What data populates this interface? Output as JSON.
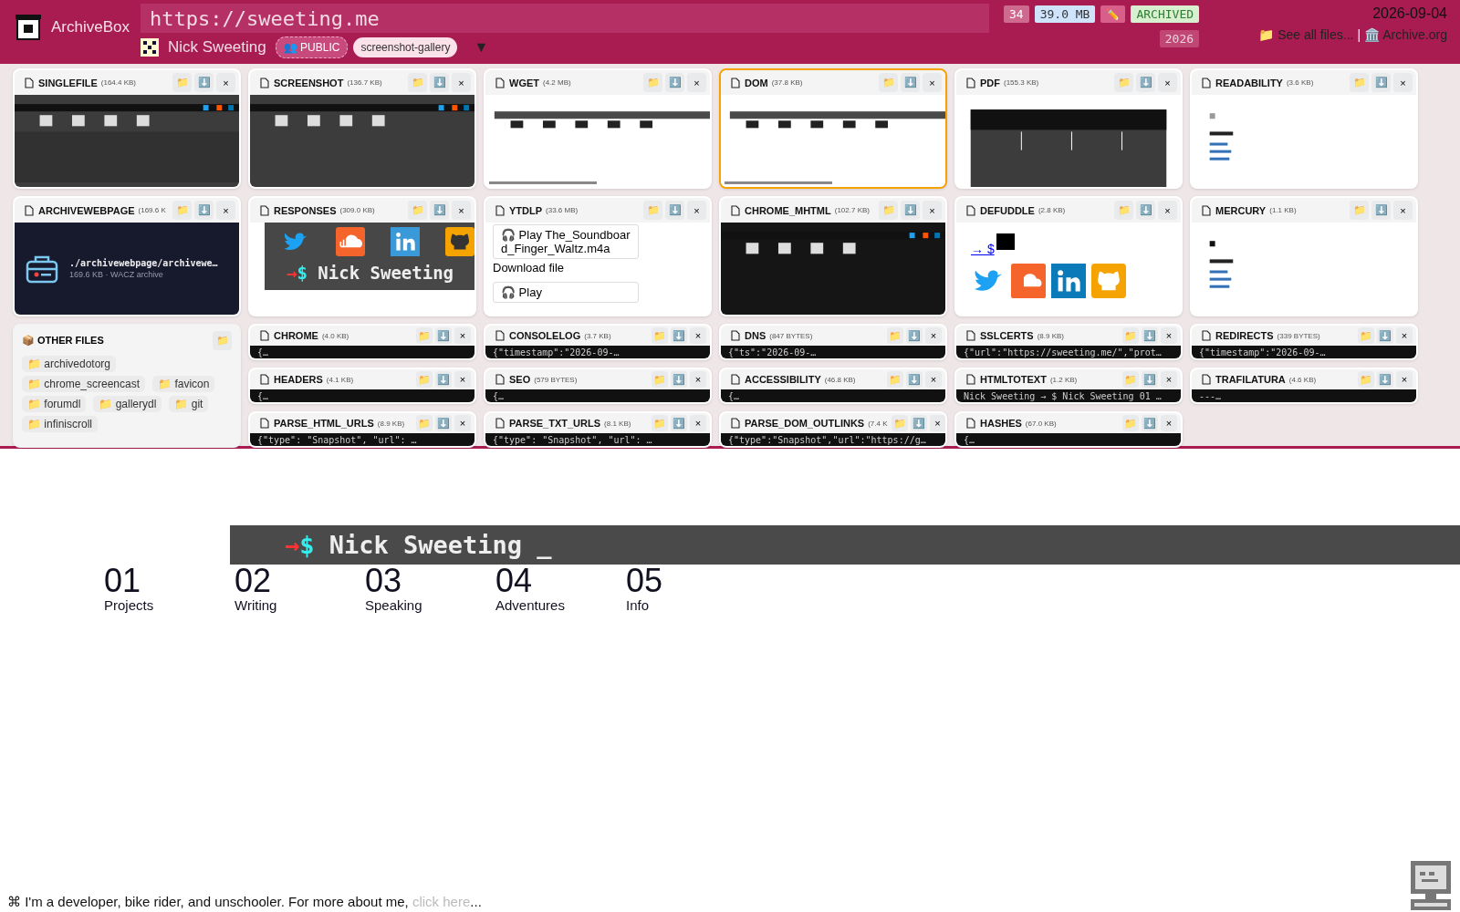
{
  "header": {
    "logo_text": "ArchiveBox",
    "url": "https://sweeting.me",
    "title": "Nick Sweeting",
    "tags": [
      {
        "kind": "public",
        "icon": "👥",
        "label": "PUBLIC"
      },
      {
        "kind": "tag",
        "label": "screenshot-gallery"
      }
    ],
    "dropdown": "▼",
    "count": "34",
    "size": "39.0 MB",
    "edit": "✏️",
    "status": "ARCHIVED",
    "year": "2026",
    "date": "2026-09-04",
    "files_link": "📁 See all files...",
    "separator": "|",
    "archive_link": "🏛️ Archive.org"
  },
  "cards": [
    {
      "name": "SINGLEFILE",
      "size": "(164.4 KB)",
      "selected": false,
      "kind": "picture",
      "actions": [
        "📁",
        "⬇️",
        "×"
      ]
    },
    {
      "name": "SCREENSHOT",
      "size": "(136.7 KB)",
      "selected": false,
      "kind": "picture",
      "actions": [
        "📁",
        "⬇️",
        "×"
      ]
    },
    {
      "name": "WGET",
      "size": "(4.2 MB)",
      "selected": false,
      "kind": "picture",
      "actions": [
        "📁",
        "⬇️",
        "×"
      ]
    },
    {
      "name": "DOM",
      "size": "(37.8 KB)",
      "selected": true,
      "kind": "picture",
      "actions": [
        "📁",
        "⬇️",
        "×"
      ]
    },
    {
      "name": "PDF",
      "size": "(155.3 KB)",
      "selected": false,
      "kind": "picture",
      "actions": [
        "📁",
        "⬇️",
        "×"
      ]
    },
    {
      "name": "READABILITY",
      "size": "(3.6 KB)",
      "selected": false,
      "kind": "picture",
      "actions": [
        "📁",
        "⬇️",
        "×"
      ]
    },
    {
      "name": "ARCHIVEWEBPAGE",
      "size": "(169.6 K",
      "selected": false,
      "kind": "archive",
      "path": "./archivewebpage/archivewe…",
      "detail": "169.6 KB · WACZ archive",
      "actions": [
        "📁",
        "⬇️",
        "×"
      ]
    },
    {
      "name": "RESPONSES",
      "size": "(309.0 KB)",
      "selected": false,
      "kind": "responses",
      "prompt": "→$",
      "text": "Nick Sweeting",
      "actions": [
        "📁",
        "⬇️",
        "×"
      ]
    },
    {
      "name": "YTDLP",
      "size": "(33.6 MB)",
      "selected": false,
      "kind": "media",
      "items": [
        {
          "kind": "play",
          "icon": "🎧",
          "label": "Play The_Soundboard_Finger_Waltz.m4a"
        },
        {
          "kind": "link",
          "label": "Download file"
        },
        {
          "kind": "play",
          "icon": "🎧",
          "label": "Play"
        }
      ],
      "actions": [
        "📁",
        "⬇️",
        "×"
      ]
    },
    {
      "name": "CHROME_MHTML",
      "size": "(102.7 KB)",
      "selected": false,
      "kind": "picture",
      "actions": [
        "📁",
        "⬇️",
        "×"
      ]
    },
    {
      "name": "DEFUDDLE",
      "size": "(2.8 KB)",
      "selected": false,
      "kind": "links",
      "link": "→ $",
      "actions": [
        "📁",
        "⬇️",
        "×"
      ]
    },
    {
      "name": "MERCURY",
      "size": "(1.1 KB)",
      "selected": false,
      "kind": "picture",
      "actions": [
        "📁",
        "⬇️",
        "×"
      ]
    }
  ],
  "other_files": {
    "title": "📦 OTHER FILES",
    "action": "📁",
    "folders": [
      "📁 archivedotorg",
      "📁 chrome_screencast",
      "📁 favicon",
      "📁 forumdl",
      "📁 gallerydl",
      "📁 git",
      "📁 infiniscroll"
    ]
  },
  "text_cards": [
    {
      "name": "CHROME",
      "size": "(4.0 KB)",
      "snippet": "{…",
      "actions": [
        "📁",
        "⬇️",
        "×"
      ]
    },
    {
      "name": "CONSOLELOG",
      "size": "(3.7 KB)",
      "snippet": "{\"timestamp\":\"2026-09-…",
      "actions": [
        "📁",
        "⬇️",
        "×"
      ]
    },
    {
      "name": "DNS",
      "size": "(847 BYTES)",
      "snippet": "{\"ts\":\"2026-09-…",
      "actions": [
        "📁",
        "⬇️",
        "×"
      ]
    },
    {
      "name": "SSLCERTS",
      "size": "(8.9 KB)",
      "snippet": "{\"url\":\"https://sweeting.me/\",\"prot…",
      "actions": [
        "📁",
        "⬇️",
        "×"
      ]
    },
    {
      "name": "REDIRECTS",
      "size": "(339 BYTES)",
      "snippet": "{\"timestamp\":\"2026-09-…",
      "actions": [
        "📁",
        "⬇️",
        "×"
      ]
    },
    {
      "name": "HEADERS",
      "size": "(4.1 KB)",
      "snippet": "{…",
      "actions": [
        "📁",
        "⬇️",
        "×"
      ]
    },
    {
      "name": "SEO",
      "size": "(579 BYTES)",
      "snippet": "{…",
      "actions": [
        "📁",
        "⬇️",
        "×"
      ]
    },
    {
      "name": "ACCESSIBILITY",
      "size": "(46.8 KB)",
      "snippet": "{…",
      "actions": [
        "📁",
        "⬇️",
        "×"
      ]
    },
    {
      "name": "HTMLTOTEXT",
      "size": "(1.2 KB)",
      "snippet": "Nick Sweeting → $ Nick Sweeting 01 …",
      "actions": [
        "📁",
        "⬇️",
        "×"
      ]
    },
    {
      "name": "TRAFILATURA",
      "size": "(4.6 KB)",
      "snippet": "---…",
      "actions": [
        "📁",
        "⬇️",
        "×"
      ]
    },
    {
      "name": "PARSE_HTML_URLS",
      "size": "(8.9 KB)",
      "snippet": "{\"type\": \"Snapshot\", \"url\": …",
      "actions": [
        "📁",
        "⬇️",
        "×"
      ]
    },
    {
      "name": "PARSE_TXT_URLS",
      "size": "(8.1 KB)",
      "snippet": "{\"type\": \"Snapshot\", \"url\": …",
      "actions": [
        "📁",
        "⬇️",
        "×"
      ]
    },
    {
      "name": "PARSE_DOM_OUTLINKS",
      "size": "(7.4 K",
      "snippet": "{\"type\":\"Snapshot\",\"url\":\"https://g…",
      "actions": [
        "📁",
        "⬇️",
        "×"
      ]
    },
    {
      "name": "HASHES",
      "size": "(67.0 KB)",
      "snippet": "{…",
      "actions": [
        "📁",
        "⬇️",
        "×"
      ]
    }
  ],
  "page_preview": {
    "prompt_arrow": "→",
    "prompt_dollar": "$",
    "heading": "Nick Sweeting _",
    "nav": [
      {
        "number": "01",
        "label": "Projects"
      },
      {
        "number": "02",
        "label": "Writing"
      },
      {
        "number": "03",
        "label": "Speaking"
      },
      {
        "number": "04",
        "label": "Adventures"
      },
      {
        "number": "05",
        "label": "Info"
      }
    ],
    "footer_icon": "⌘",
    "footer_text": "I'm a developer, bike rider, and unschooler. For more about me,",
    "footer_link": "click here",
    "footer_end": "..."
  }
}
